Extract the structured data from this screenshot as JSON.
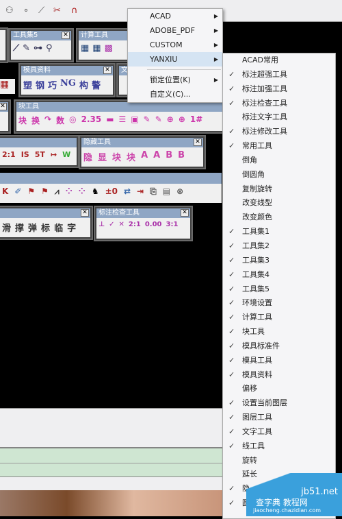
{
  "colors": {
    "menu_highlight": "#d5e4f3",
    "title_bar": "#8fa6c4",
    "green_band": "#cfe6d2"
  },
  "top_toolbar": {
    "icons": [
      "layer-circles-icon",
      "dot-icon",
      "trim-icon",
      "break-icon",
      "magnet-icon"
    ]
  },
  "panels": {
    "toolset5": {
      "title": "工具集5",
      "icons": [
        "line-icon",
        "pencil-icon",
        "connect-icon",
        "zoom-icon"
      ]
    },
    "calc": {
      "title": "计算工具",
      "icons": [
        "calculator-icon",
        "calculator-icon",
        "calendar-icon"
      ]
    },
    "mold_info": {
      "title": "模具资料",
      "buttons": [
        "塑",
        "钢",
        "巧",
        "NG",
        "构",
        "警"
      ]
    },
    "text_partial": {
      "title": "文"
    },
    "block": {
      "title": "块工具",
      "buttons": [
        "块",
        "换",
        "↷",
        "数",
        "◎",
        "2.35",
        "▬",
        "☰",
        "▣",
        "✎",
        "✎",
        "⊕",
        "⊕",
        "1#"
      ]
    },
    "hidden": {
      "title": "隐藏工具",
      "buttons": [
        "隐",
        "显",
        "块",
        "块",
        "A",
        "A",
        "B",
        "B"
      ]
    },
    "dim_check": {
      "title": "标注检查工具",
      "buttons": [
        "⊥",
        "✓",
        "✕",
        "2:1",
        "0.00",
        "3:1"
      ]
    },
    "misc": {
      "buttons": [
        "滑",
        "撑",
        "弹",
        "标",
        "临",
        "字"
      ]
    }
  },
  "menu": {
    "items": [
      {
        "label": "ACAD",
        "submenu": true
      },
      {
        "label": "ADOBE_PDF",
        "submenu": true
      },
      {
        "label": "CUSTOM",
        "submenu": true
      },
      {
        "label": "YANXIU",
        "submenu": true,
        "highlighted": true
      },
      {
        "label": "锁定位置(K)",
        "submenu": true
      },
      {
        "label": "自定义(C)...",
        "submenu": false
      }
    ]
  },
  "submenu": {
    "items": [
      {
        "label": "ACAD常用",
        "checked": false
      },
      {
        "label": "标注超强工具",
        "checked": true
      },
      {
        "label": "标注加强工具",
        "checked": true
      },
      {
        "label": "标注检查工具",
        "checked": true
      },
      {
        "label": "标注文字工具",
        "checked": false
      },
      {
        "label": "标注修改工具",
        "checked": true
      },
      {
        "label": "常用工具",
        "checked": true
      },
      {
        "label": "倒角",
        "checked": false
      },
      {
        "label": "倒圆角",
        "checked": false
      },
      {
        "label": "复制旋转",
        "checked": false
      },
      {
        "label": "改变线型",
        "checked": false
      },
      {
        "label": "改变颜色",
        "checked": false
      },
      {
        "label": "工具集1",
        "checked": true
      },
      {
        "label": "工具集2",
        "checked": true
      },
      {
        "label": "工具集3",
        "checked": true
      },
      {
        "label": "工具集4",
        "checked": true
      },
      {
        "label": "工具集5",
        "checked": true
      },
      {
        "label": "环境设置",
        "checked": true
      },
      {
        "label": "计算工具",
        "checked": true
      },
      {
        "label": "块工具",
        "checked": true
      },
      {
        "label": "模具标准件",
        "checked": true
      },
      {
        "label": "模具工具",
        "checked": true
      },
      {
        "label": "模具资料",
        "checked": true
      },
      {
        "label": "偏移",
        "checked": false
      },
      {
        "label": "设置当前图层",
        "checked": true
      },
      {
        "label": "图层工具",
        "checked": true
      },
      {
        "label": "文字工具",
        "checked": true
      },
      {
        "label": "线工具",
        "checked": true
      },
      {
        "label": "旋转",
        "checked": false
      },
      {
        "label": "延长",
        "checked": false
      },
      {
        "label": "隐",
        "checked": true
      },
      {
        "label": "圆",
        "checked": true
      }
    ]
  },
  "watermark": {
    "line1": "jb51.net",
    "line2": "查字典 教程网",
    "line3": "jiaocheng.chazidian.com"
  }
}
